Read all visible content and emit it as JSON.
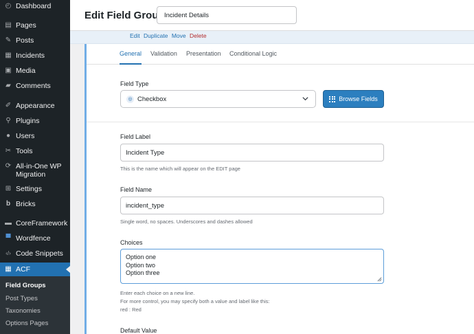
{
  "sidebar": {
    "items": [
      {
        "label": "Dashboard",
        "icon": "dashboard-icon",
        "glyph": "◴"
      },
      {
        "label": "Pages",
        "icon": "pages-icon",
        "glyph": "▤"
      },
      {
        "label": "Posts",
        "icon": "pin-icon",
        "glyph": "✎"
      },
      {
        "label": "Incidents",
        "icon": "incidents-icon",
        "glyph": "▦"
      },
      {
        "label": "Media",
        "icon": "media-icon",
        "glyph": "▣"
      },
      {
        "label": "Comments",
        "icon": "comments-icon",
        "glyph": "▰"
      },
      {
        "label": "Appearance",
        "icon": "appearance-icon",
        "glyph": "✐"
      },
      {
        "label": "Plugins",
        "icon": "plugins-icon",
        "glyph": "⚲"
      },
      {
        "label": "Users",
        "icon": "users-icon",
        "glyph": "●"
      },
      {
        "label": "Tools",
        "icon": "tools-icon",
        "glyph": "✂"
      },
      {
        "label": "All-in-One WP Migration",
        "line1": "All-in-One WP",
        "line2": "Migration",
        "icon": "migration-icon",
        "glyph": "⟳"
      },
      {
        "label": "Settings",
        "icon": "settings-icon",
        "glyph": "⊞"
      },
      {
        "label": "Bricks",
        "icon": "bricks-icon",
        "glyph": "b"
      },
      {
        "label": "CoreFramework",
        "icon": "coreframework-icon",
        "glyph": "▬"
      },
      {
        "label": "Wordfence",
        "icon": "wordfence-icon",
        "glyph": "▀"
      },
      {
        "label": "Code Snippets",
        "icon": "code-icon",
        "glyph": "‹/›"
      },
      {
        "label": "ACF",
        "icon": "acf-icon",
        "glyph": "▦"
      }
    ],
    "submenu": [
      "Field Groups",
      "Post Types",
      "Taxonomies",
      "Options Pages"
    ]
  },
  "header": {
    "title": "Edit Field Group",
    "group_name": "Incident Details"
  },
  "row_actions": [
    "Edit",
    "Duplicate",
    "Move",
    "Delete"
  ],
  "tabs": [
    "General",
    "Validation",
    "Presentation",
    "Conditional Logic"
  ],
  "active_tab": "General",
  "field": {
    "type_label": "Field Type",
    "type_value": "Checkbox",
    "browse_label": "Browse Fields",
    "label_label": "Field Label",
    "label_value": "Incident Type",
    "label_hint": "This is the name which will appear on the EDIT page",
    "name_label": "Field Name",
    "name_value": "incident_type",
    "name_hint": "Single word, no spaces. Underscores and dashes allowed",
    "choices_label": "Choices",
    "choices": [
      "Option one",
      "Option two",
      "Option three"
    ],
    "choices_hints": [
      "Enter each choice on a new line.",
      "For more control, you may specify both a value and label like this:",
      "red : Red"
    ],
    "default_label": "Default Value"
  },
  "colors": {
    "sidebar_bg": "#1d2327",
    "accent": "#2271b1",
    "danger": "#b32d2e",
    "button": "#2c7fbf"
  }
}
